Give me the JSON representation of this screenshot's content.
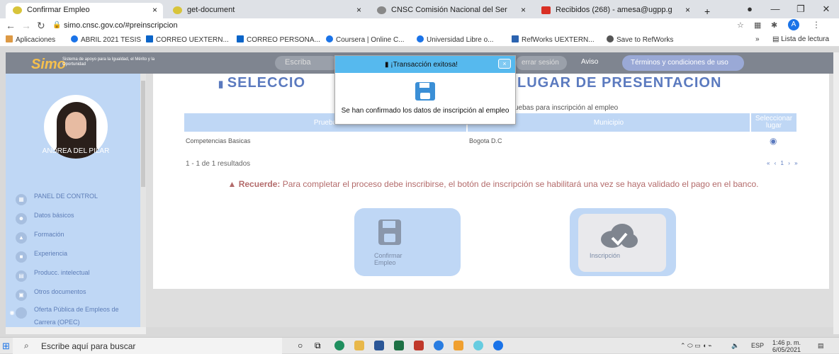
{
  "browser": {
    "tabs": [
      {
        "title": "Confirmar Empleo",
        "color": "#d8c43a"
      },
      {
        "title": "get-document",
        "color": "#d8c43a"
      },
      {
        "title": "CNSC Comisión Nacional del Ser",
        "color": "#888888"
      },
      {
        "title": "Recibidos (268) - amesa@ugpp.g",
        "color": "#d93025"
      }
    ],
    "new_tab": "+",
    "url": "simo.cnsc.gov.co/#preinscripcion",
    "bookmarks": [
      "Aplicaciones",
      "ABRIL 2021 TESIS",
      "CORREO UEXTERN...",
      "CORREO PERSONA...",
      "Coursera | Online C...",
      "Universidad Libre o...",
      "RefWorks UEXTERN...",
      "Save to RefWorks"
    ],
    "reading_list": "Lista de lectura"
  },
  "header": {
    "logo": "Simo",
    "logo_text": "Sistema de apoyo para la Igualdad, el Mérito y la Oportunidad",
    "search_placeholder": "Escriba",
    "close_session": "errar sesión",
    "aviso": "Aviso",
    "terms": "Términos y condiciones de uso"
  },
  "sidebar": {
    "user": "ANDREA DEL PILAR",
    "items": [
      "PANEL DE CONTROL",
      "Datos básicos",
      "Formación",
      "Experiencia",
      "Producc. intelectual",
      "Otros documentos",
      "Oferta Pública de Empleos de Carrera (OPEC)"
    ]
  },
  "main": {
    "title_left": "SELECCIO",
    "title_right": "LUGAR DE PRESENTACION",
    "subtitle": "uebas para inscripción al empleo",
    "columns": [
      "Prueba",
      "Municipio",
      "Seleccionar lugar"
    ],
    "rows": [
      {
        "prueba": "Competencias Basicas",
        "municipio": "Bogota D.C"
      }
    ],
    "results": "1 - 1 de 1 resultados",
    "pager": "« ‹ 1 › »",
    "warning_label": "Recuerde:",
    "warning_text": "Para completar el proceso debe inscribirse, el botón de inscripción se habilitará una vez se haya validado el pago en el banco.",
    "btn_confirm": "Confirmar Empleo",
    "btn_inscripcion": "Inscripción"
  },
  "modal": {
    "title": "¡Transacción exitosa!",
    "close": "×",
    "message": "Se han confirmado los datos de inscripción al empleo"
  },
  "taskbar": {
    "search": "Escribe aquí para buscar",
    "lang": "ESP",
    "time": "1:46 p. m.",
    "date": "6/05/2021"
  }
}
